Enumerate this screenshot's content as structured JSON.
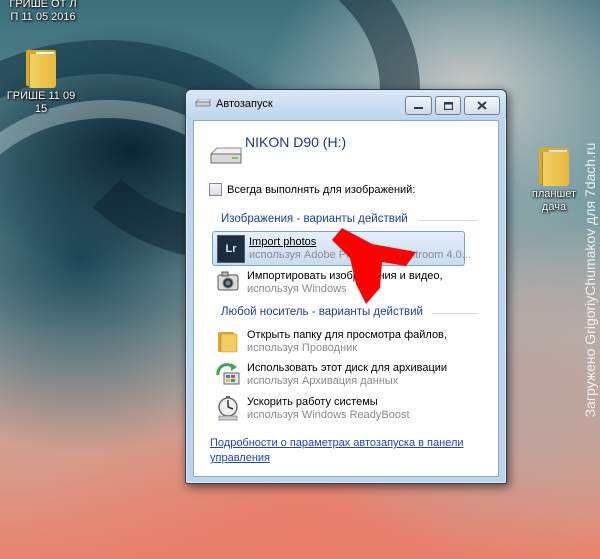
{
  "desktop": {
    "top_label_line1": "ГРИШЕ ОТ Л",
    "top_label_line2": "П 11 05 2016",
    "folder1_label": "ГРИШЕ 11 09 15",
    "folder2_label": "планшет дача"
  },
  "watermark": "Загружено GrigoriyChumakov для 7dach.ru",
  "dialog": {
    "title": "Автозапуск",
    "device_name": "NIKON D90 (H:)",
    "always_do_label": "Всегда выполнять для изображений:",
    "always_do_checked": false,
    "section_images": "Изображения - варианты действий",
    "section_any": "Любой носитель - варианты действий",
    "image_options": [
      {
        "title": "Import photos",
        "subtitle": "используя Adobe Photoshop Lightroom 4.0...",
        "icon": "lightroom-icon",
        "icon_text": "Lr"
      },
      {
        "title": "Импортировать изображения и видео,",
        "subtitle": "используя Windows",
        "icon": "camera-icon"
      }
    ],
    "general_options": [
      {
        "title": "Открыть папку для просмотра файлов,",
        "subtitle": "используя Проводник",
        "icon": "folder-icon"
      },
      {
        "title": "Использовать этот диск для архивации",
        "subtitle": "используя Архивация данных",
        "icon": "backup-icon"
      },
      {
        "title": "Ускорить работу системы",
        "subtitle": "используя Windows ReadyBoost",
        "icon": "readyboost-icon"
      }
    ],
    "footer_link": "Подробности о параметрах автозапуска в панели управления"
  },
  "colors": {
    "accent_link": "#1a46c7",
    "section_text": "#1e3f9c",
    "annotation_arrow": "#ff0000"
  }
}
